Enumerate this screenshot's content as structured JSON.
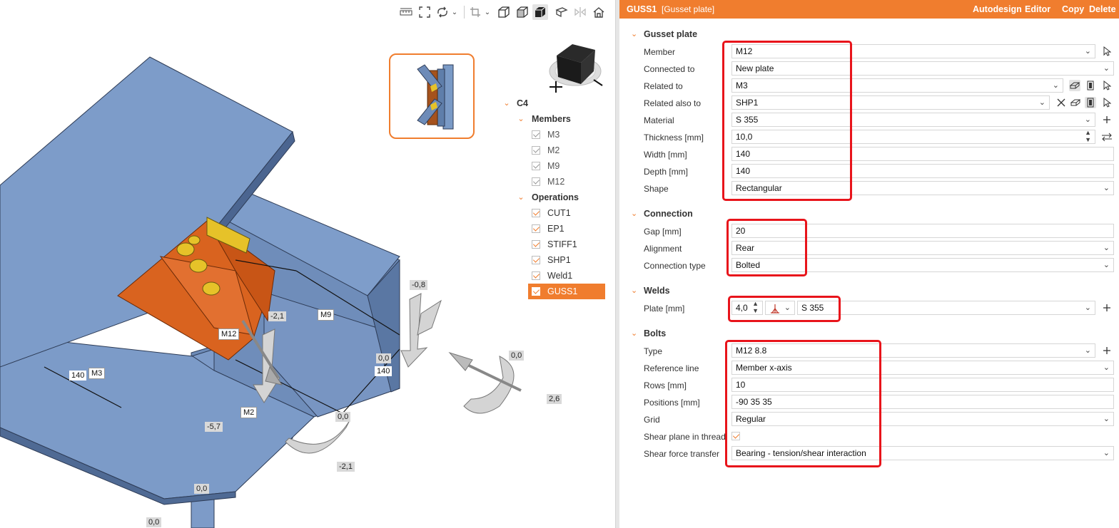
{
  "viewport": {
    "toolbar": [
      "measure-icon",
      "fit-icon",
      "rotate-icon",
      "chevron-down-icon",
      "crop-icon",
      "chevron-down-icon",
      "wireframe-icon",
      "transparent-icon",
      "solid-icon",
      "section-icon",
      "mirror-icon",
      "home-icon"
    ],
    "labels": {
      "m3": "M3",
      "m9": "M9",
      "m12": "M12",
      "m2": "M2",
      "dim_140a": "140",
      "dim_140b": "140"
    },
    "loads": [
      "-0,8",
      "-2,1",
      "0,0",
      "0,0",
      "2,6",
      "0,0",
      "-5,7",
      "-2,1",
      "0,0",
      "0,0"
    ]
  },
  "tree": {
    "root": "C4",
    "members_title": "Members",
    "members": [
      "M3",
      "M2",
      "M9",
      "M12"
    ],
    "operations_title": "Operations",
    "operations": [
      "CUT1",
      "EP1",
      "STIFF1",
      "SHP1",
      "Weld1",
      "GUSS1"
    ],
    "selected": "GUSS1"
  },
  "panel": {
    "title": "GUSS1",
    "subtitle": "[Gusset plate]",
    "actions": [
      "Autodesign",
      "Editor",
      "Copy",
      "Delete"
    ],
    "sections": {
      "gusset": {
        "title": "Gusset plate",
        "member_label": "Member",
        "member": "M12",
        "connected_label": "Connected to",
        "connected": "New plate",
        "related_label": "Related to",
        "related": "M3",
        "related_also_label": "Related also to",
        "related_also": "SHP1",
        "material_label": "Material",
        "material": "S 355",
        "thickness_label": "Thickness [mm]",
        "thickness": "10,0",
        "width_label": "Width [mm]",
        "width": "140",
        "depth_label": "Depth [mm]",
        "depth": "140",
        "shape_label": "Shape",
        "shape": "Rectangular"
      },
      "connection": {
        "title": "Connection",
        "gap_label": "Gap [mm]",
        "gap": "20",
        "alignment_label": "Alignment",
        "alignment": "Rear",
        "type_label": "Connection type",
        "type": "Bolted"
      },
      "welds": {
        "title": "Welds",
        "plate_label": "Plate [mm]",
        "plate_size": "4,0",
        "plate_material": "S 355"
      },
      "bolts": {
        "title": "Bolts",
        "type_label": "Type",
        "type": "M12 8.8",
        "refline_label": "Reference line",
        "refline": "Member x-axis",
        "rows_label": "Rows [mm]",
        "rows": "10",
        "positions_label": "Positions [mm]",
        "positions": "-90 35 35",
        "grid_label": "Grid",
        "grid": "Regular",
        "shear_plane_label": "Shear plane in thread",
        "shear_plane_checked": true,
        "shear_force_label": "Shear force transfer",
        "shear_force": "Bearing - tension/shear interaction"
      }
    }
  },
  "colors": {
    "accent": "#f07d2e",
    "steel": "#7a9ac6",
    "gusset": "#d9631f",
    "bolt": "#e6c229",
    "highlight": "#e8141b"
  }
}
